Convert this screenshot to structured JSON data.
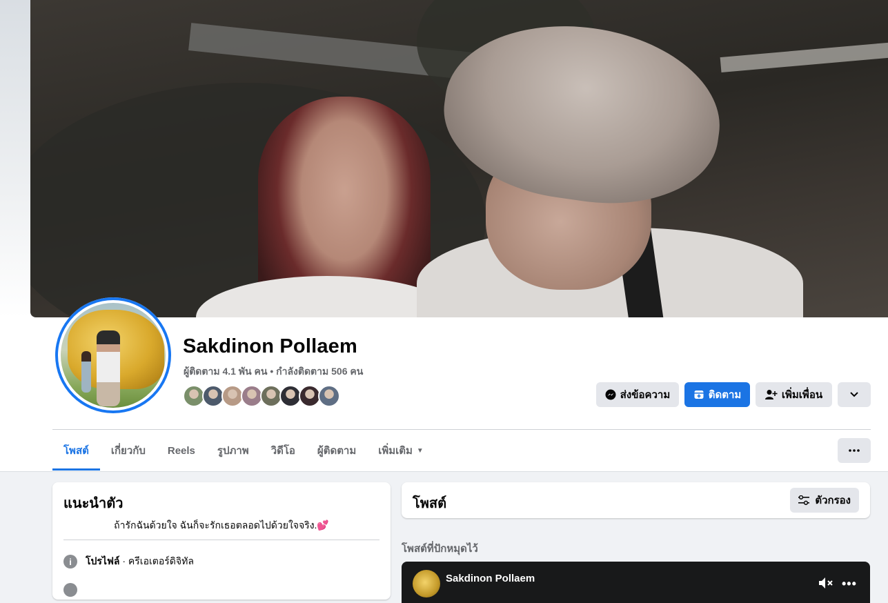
{
  "profile": {
    "name": "Sakdinon Pollaem",
    "follow_info": "ผู้ติดตาม 4.1 พัน คน • กำลังติดตาม 506 คน",
    "friend_avatar_colors": [
      "#7a8f6a",
      "#4d5a6b",
      "#b79a86",
      "#9a7d8a",
      "#6d6f5c",
      "#2e2e35",
      "#3a2a2e",
      "#5f6e84"
    ]
  },
  "actions": {
    "message": "ส่งข้อความ",
    "follow": "ติดตาม",
    "add_friend": "เพิ่มเพื่อน"
  },
  "tabs": [
    {
      "label": "โพสต์",
      "active": true
    },
    {
      "label": "เกี่ยวกับ",
      "active": false
    },
    {
      "label": "Reels",
      "active": false
    },
    {
      "label": "รูปภาพ",
      "active": false
    },
    {
      "label": "วิดีโอ",
      "active": false
    },
    {
      "label": "ผู้ติดตาม",
      "active": false
    },
    {
      "label": "เพิ่มเติม",
      "active": false
    }
  ],
  "intro": {
    "title": "แนะนำตัว",
    "bio": "ถ้ารักฉันด้วยใจ ฉันก็จะรักเธอตลอดไปด้วยใจจริง.💕",
    "profile_label": "โปรไฟล์",
    "profile_value": "ครีเอเตอร์ดิจิทัล"
  },
  "posts": {
    "title": "โพสต์",
    "filter_label": "ตัวกรอง",
    "pinned_label": "โพสต์ที่ปักหมุดไว้",
    "pinned_author": "Sakdinon Pollaem"
  },
  "colors": {
    "accent": "#1b74e4",
    "button_gray": "#e4e6eb",
    "secondary_text": "#65676b",
    "page_bg": "#f0f2f5"
  }
}
